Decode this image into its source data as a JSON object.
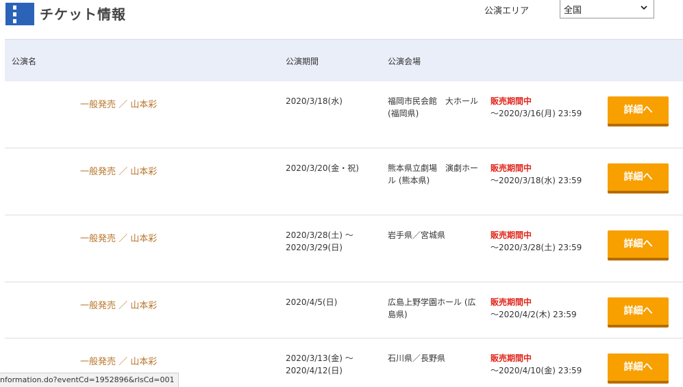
{
  "header": {
    "title": "チケット情報",
    "area_label": "公演エリア",
    "area_value": "全国"
  },
  "table": {
    "columns": {
      "name": "公演名",
      "date": "公演期間",
      "venue": "公演会場"
    },
    "detail_label": "詳細へ",
    "rows": [
      {
        "name": "一般発売 ／ 山本彩",
        "date": "2020/3/18(水)",
        "venue": "福岡市民会館　大ホール (福岡県)",
        "status": "販売期間中",
        "period": "～2020/3/16(月) 23:59"
      },
      {
        "name": "一般発売 ／ 山本彩",
        "date": "2020/3/20(金・祝)",
        "venue": "熊本県立劇場　演劇ホール (熊本県)",
        "status": "販売期間中",
        "period": "～2020/3/18(水) 23:59"
      },
      {
        "name": "一般発売 ／ 山本彩",
        "date": "2020/3/28(土) ～ 2020/3/29(日)",
        "venue": "岩手県／宮城県",
        "status": "販売期間中",
        "period": "～2020/3/28(土) 23:59"
      },
      {
        "name": "一般発売 ／ 山本彩",
        "date": "2020/4/5(日)",
        "venue": "広島上野学園ホール (広島県)",
        "status": "販売期間中",
        "period": "～2020/4/2(木) 23:59"
      },
      {
        "name": "一般発売 ／ 山本彩",
        "date": "2020/3/13(金) ～ 2020/4/12(日)",
        "venue": "石川県／長野県",
        "status": "販売期間中",
        "period": "～2020/4/10(金) 23:59"
      }
    ]
  },
  "statusbar": {
    "url": "nformation.do?eventCd=1952896&rlsCd=001"
  },
  "colors": {
    "brand_blue": "#2b63b9",
    "name_link": "#b8752b",
    "status_red": "#e0261b",
    "button_orange": "#f7a000"
  }
}
